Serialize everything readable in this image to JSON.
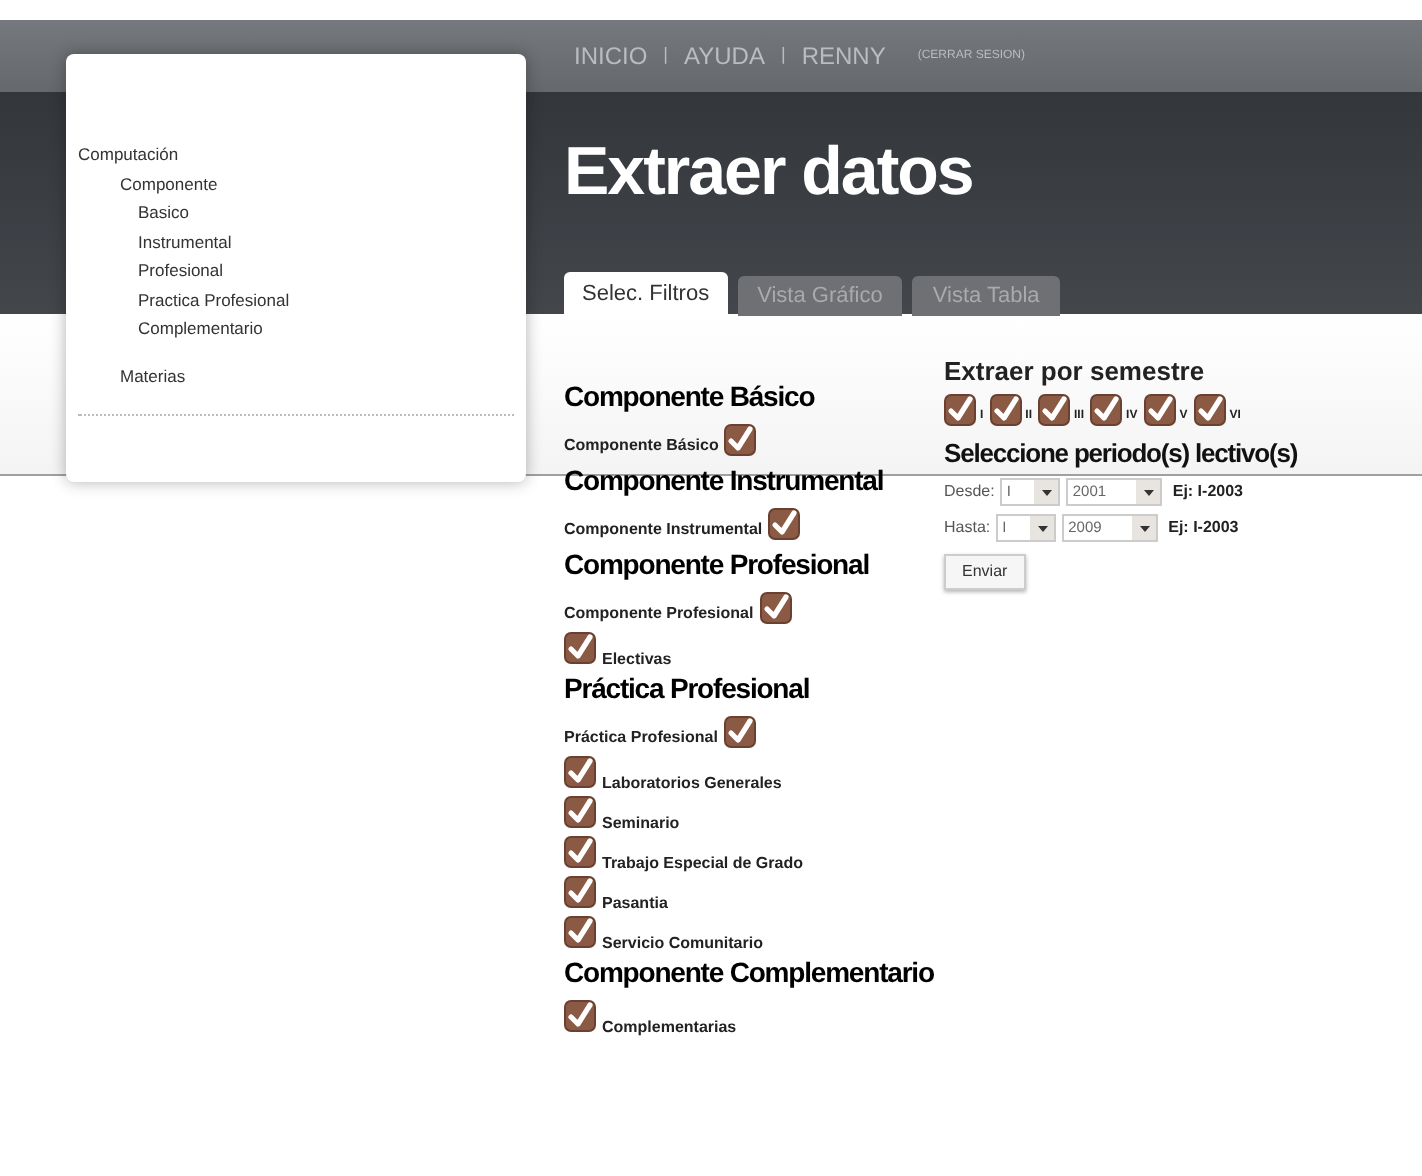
{
  "nav": {
    "links": [
      "INICIO",
      "AYUDA",
      "RENNY"
    ],
    "separators": [
      "|",
      "|"
    ],
    "logout": "(CERRAR SESION)"
  },
  "sidebar": {
    "items": [
      {
        "label": "Computación",
        "children": [
          {
            "label": "Componente",
            "children": [
              {
                "label": "Basico"
              },
              {
                "label": "Instrumental"
              },
              {
                "label": "Profesional"
              },
              {
                "label": "Practica Profesional"
              },
              {
                "label": "Complementario"
              }
            ]
          },
          {
            "label": "Materias"
          }
        ]
      }
    ]
  },
  "page_title": "Extraer datos",
  "tabs": [
    {
      "label": "Selec. Filtros",
      "selected": true
    },
    {
      "label": "Vista Gráfico",
      "selected": false
    },
    {
      "label": "Vista Tabla",
      "selected": false
    }
  ],
  "groups": [
    {
      "heading": "Componente Básico",
      "items": [
        {
          "kind": "label-first",
          "label": "Componente Básico",
          "checked": true
        }
      ]
    },
    {
      "heading": "Componente Instrumental",
      "items": [
        {
          "kind": "label-first",
          "label": "Componente Instrumental",
          "checked": true
        }
      ]
    },
    {
      "heading": "Componente Profesional",
      "items": [
        {
          "kind": "label-first",
          "label": "Componente Profesional",
          "checked": true
        },
        {
          "kind": "box-first",
          "label": "Electivas",
          "checked": true
        }
      ]
    },
    {
      "heading": "Práctica Profesional",
      "items": [
        {
          "kind": "label-first",
          "label": "Práctica Profesional",
          "checked": true
        },
        {
          "kind": "box-first",
          "label": "Laboratorios Generales",
          "checked": true
        },
        {
          "kind": "box-first",
          "label": "Seminario",
          "checked": true
        },
        {
          "kind": "box-first",
          "label": "Trabajo Especial de Grado",
          "checked": true
        },
        {
          "kind": "box-first",
          "label": "Pasantia",
          "checked": true
        },
        {
          "kind": "box-first",
          "label": "Servicio Comunitario",
          "checked": true
        }
      ]
    },
    {
      "heading": "Componente Complementario",
      "items": [
        {
          "kind": "box-first",
          "label": "Complementarias",
          "checked": true
        }
      ]
    }
  ],
  "semester": {
    "heading": "Extraer por semestre",
    "options": [
      {
        "label": "I",
        "checked": true
      },
      {
        "label": "II",
        "checked": true
      },
      {
        "label": "III",
        "checked": true
      },
      {
        "label": "IV",
        "checked": true
      },
      {
        "label": "V",
        "checked": true
      },
      {
        "label": "VI",
        "checked": true
      }
    ]
  },
  "period": {
    "heading": "Seleccione periodo(s) lectivo(s)",
    "rows": [
      {
        "label": "Desde:",
        "term": "I",
        "year": "2001",
        "example": "Ej: I-2003"
      },
      {
        "label": "Hasta:",
        "term": "I",
        "year": "2009",
        "example": "Ej: I-2003"
      }
    ],
    "submit": "Enviar"
  }
}
